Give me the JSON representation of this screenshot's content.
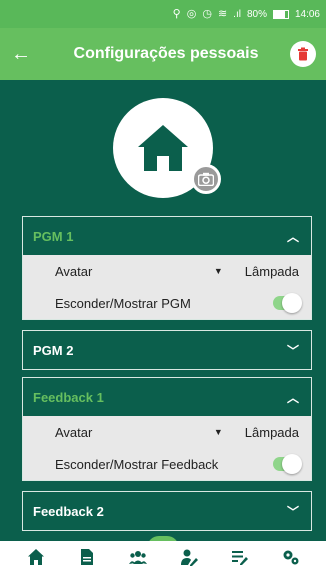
{
  "status_bar": {
    "battery_text": "80%",
    "time": "14:06"
  },
  "header": {
    "title": "Configurações pessoais"
  },
  "panels": [
    {
      "title": "PGM 1",
      "expanded": true,
      "rows": [
        {
          "label": "Avatar",
          "value": "Lâmpada",
          "kind": "select"
        },
        {
          "label": "Esconder/Mostrar PGM",
          "kind": "toggle",
          "on": true
        }
      ]
    },
    {
      "title": "PGM 2",
      "expanded": false
    },
    {
      "title": "Feedback 1",
      "expanded": true,
      "rows": [
        {
          "label": "Avatar",
          "value": "Lâmpada",
          "kind": "select"
        },
        {
          "label": "Esconder/Mostrar Feedback",
          "kind": "toggle",
          "on": true
        }
      ]
    },
    {
      "title": "Feedback 2",
      "expanded": false
    }
  ],
  "bottom_nav": [
    "home-icon",
    "document-icon",
    "users-icon",
    "user-edit-icon",
    "list-edit-icon",
    "gears-icon"
  ],
  "colors": {
    "accent": "#66bf5f",
    "background": "#0b5f4c",
    "expanded_title": "#66bf5f",
    "danger": "#e53935"
  }
}
